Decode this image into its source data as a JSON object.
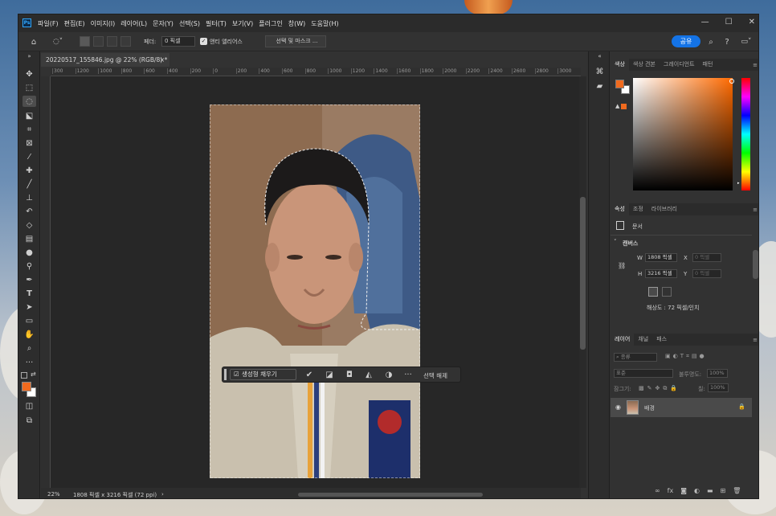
{
  "app": {
    "logo_text": "Ps"
  },
  "menu": [
    "파일(F)",
    "편집(E)",
    "이미지(I)",
    "레이어(L)",
    "문자(Y)",
    "선택(S)",
    "필터(T)",
    "보기(V)",
    "플러그인",
    "창(W)",
    "도움말(H)"
  ],
  "window_controls": {
    "minimize": "—",
    "maximize": "☐",
    "close": "✕"
  },
  "options": {
    "feather_label": "페더:",
    "feather_value": "0 픽셀",
    "antialias_label": "앤티 앨리어스",
    "antialias_checked": true,
    "select_mask_label": "선택 및 마스크 ...",
    "share_label": "공유"
  },
  "document": {
    "tab_title": "20220517_155846.jpg @ 22% (RGB/8) *",
    "close": "×"
  },
  "ruler_ticks": [
    "300",
    "1200",
    "1000",
    "800",
    "600",
    "400",
    "200",
    "0",
    "200",
    "400",
    "600",
    "800",
    "1000",
    "1200",
    "1400",
    "1600",
    "1800",
    "2000",
    "2200",
    "2400",
    "2600",
    "2800",
    "3000"
  ],
  "context_bar": {
    "generative_fill": "생성형 채우기",
    "deselect": "선택 해제",
    "more": "···"
  },
  "status": {
    "zoom": "22%",
    "info": "1808 픽셀 x 3216 픽셀 (72 ppi)",
    "arrow": "›"
  },
  "color_panel": {
    "tabs": [
      "색상",
      "색상 견본",
      "그레이디언트",
      "패턴"
    ],
    "active_tab": 0,
    "foreground": "#f06a1e",
    "background": "#ffffff",
    "hue": "#ff6a00"
  },
  "properties_panel": {
    "tabs": [
      "속성",
      "조정",
      "라이브러리"
    ],
    "active_tab": 0,
    "doc_label": "문서",
    "canvas_section": "캔버스",
    "w_label": "W",
    "w_value": "1808 픽셀",
    "h_label": "H",
    "h_value": "3216 픽셀",
    "x_label": "X",
    "x_placeholder": "0 픽셀",
    "y_label": "Y",
    "y_placeholder": "0 픽셀",
    "resolution": "해상도 : 72 픽셀/인치"
  },
  "layers_panel": {
    "tabs": [
      "레이어",
      "채널",
      "패스"
    ],
    "active_tab": 0,
    "kind_placeholder": "종류",
    "blend_mode": "표준",
    "opacity_label": "불투명도:",
    "opacity_value": "100%",
    "lock_label": "잠그기:",
    "fill_label": "칠:",
    "fill_value": "100%",
    "layers": [
      {
        "name": "배경",
        "visible": true,
        "locked": true
      }
    ],
    "footer_icons": [
      "link-icon",
      "fx-icon",
      "mask-icon",
      "adjustment-icon",
      "folder-icon",
      "new-layer-icon",
      "trash-icon"
    ]
  }
}
